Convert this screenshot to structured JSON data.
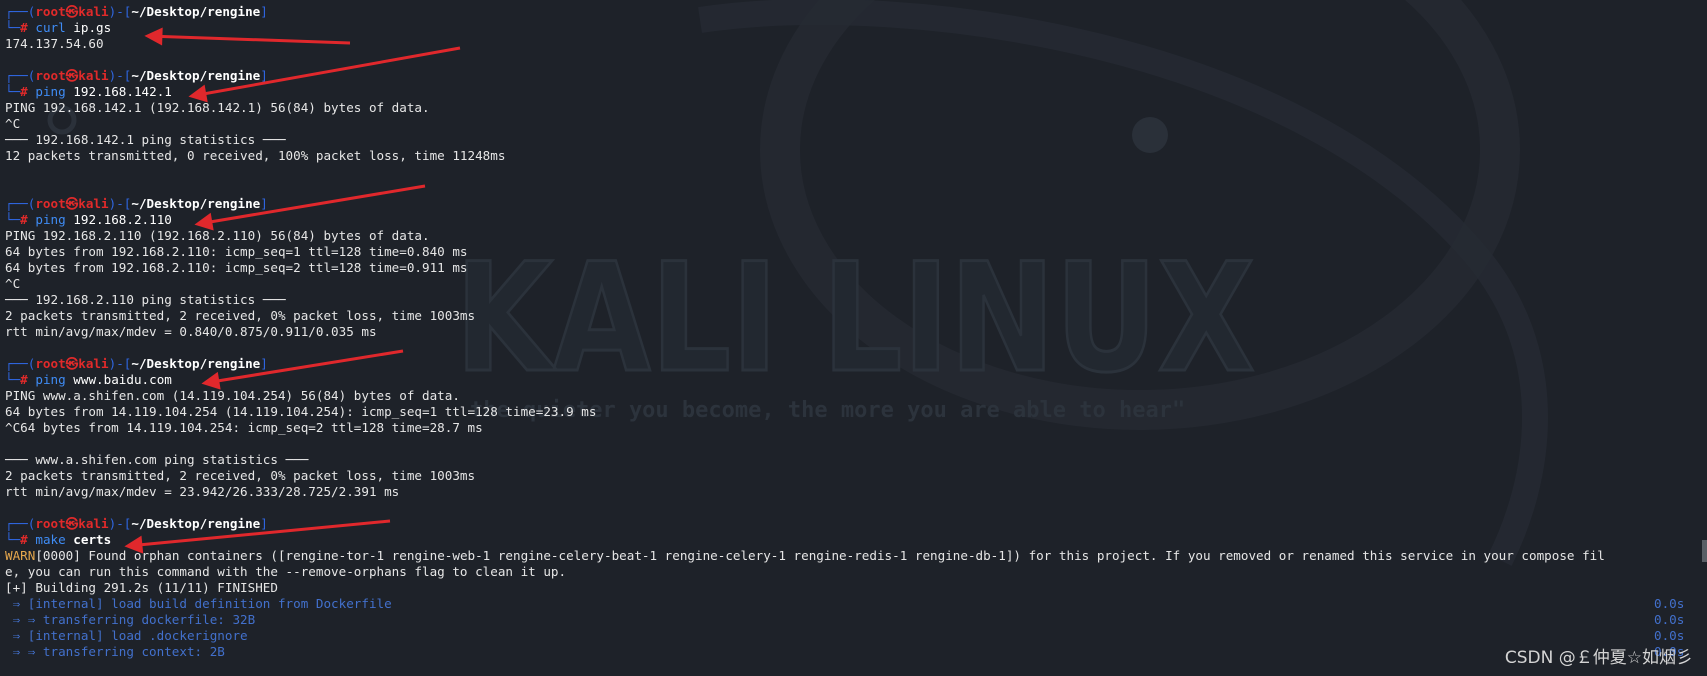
{
  "background": {
    "title": "KALI LINUX",
    "quote": "the quieter you become, the more you are able to hear\""
  },
  "prompt": {
    "corner": "┌──(",
    "user": "root㉿kali",
    "sep": ")-[",
    "path": "~/Desktop/rengine",
    "close": "]",
    "line2": "└─",
    "hash": "#"
  },
  "blocks": [
    {
      "command": "curl",
      "args": "ip.gs",
      "output": [
        "174.137.54.60"
      ],
      "blank_after": 1
    },
    {
      "command": "ping",
      "args": "192.168.142.1",
      "output": [
        "PING 192.168.142.1 (192.168.142.1) 56(84) bytes of data.",
        "^C",
        "─── 192.168.142.1 ping statistics ───",
        "12 packets transmitted, 0 received, 100% packet loss, time 11248ms"
      ],
      "blank_after": 2
    },
    {
      "command": "ping",
      "args": "192.168.2.110",
      "output": [
        "PING 192.168.2.110 (192.168.2.110) 56(84) bytes of data.",
        "64 bytes from 192.168.2.110: icmp_seq=1 ttl=128 time=0.840 ms",
        "64 bytes from 192.168.2.110: icmp_seq=2 ttl=128 time=0.911 ms",
        "^C",
        "─── 192.168.2.110 ping statistics ───",
        "2 packets transmitted, 2 received, 0% packet loss, time 1003ms",
        "rtt min/avg/max/mdev = 0.840/0.875/0.911/0.035 ms"
      ],
      "blank_after": 1
    },
    {
      "command": "ping",
      "args": "www.baidu.com",
      "output": [
        "PING www.a.shifen.com (14.119.104.254) 56(84) bytes of data.",
        "64 bytes from 14.119.104.254 (14.119.104.254): icmp_seq=1 ttl=128 time=23.9 ms",
        "^C64 bytes from 14.119.104.254: icmp_seq=2 ttl=128 time=28.7 ms",
        "",
        "─── www.a.shifen.com ping statistics ───",
        "2 packets transmitted, 2 received, 0% packet loss, time 1003ms",
        "rtt min/avg/max/mdev = 23.942/26.333/28.725/2.391 ms"
      ],
      "blank_after": 1
    },
    {
      "command": "make",
      "args": "certs",
      "output": [],
      "blank_after": 0
    }
  ],
  "make_output": {
    "warn_tag": "WARN",
    "warn_text": "[0000] Found orphan containers ([rengine-tor-1 rengine-web-1 rengine-celery-beat-1 rengine-celery-1 rengine-redis-1 rengine-db-1]) for this project. If you removed or renamed this service in your compose fil",
    "warn_text2": "e, you can run this command with the --remove-orphans flag to clean it up.",
    "building": "[+] Building 291.2s (11/11) FINISHED",
    "steps": [
      {
        "text": " ⇒ [internal] load build definition from Dockerfile",
        "time": "0.0s"
      },
      {
        "text": " ⇒ ⇒ transferring dockerfile: 32B",
        "time": "0.0s"
      },
      {
        "text": " ⇒ [internal] load .dockerignore",
        "time": "0.0s"
      },
      {
        "text": " ⇒ ⇒ transferring context: 2B",
        "time": "0.0s"
      }
    ]
  },
  "watermark": "CSDN @￡仲夏☆如烟彡",
  "colors": {
    "background": "#1e2229",
    "prompt_blue": "#2f66e0",
    "prompt_red": "#e02a2a",
    "arrow_red": "#e0282c",
    "warn": "#e5a74d",
    "build_blue": "#4270cc"
  }
}
